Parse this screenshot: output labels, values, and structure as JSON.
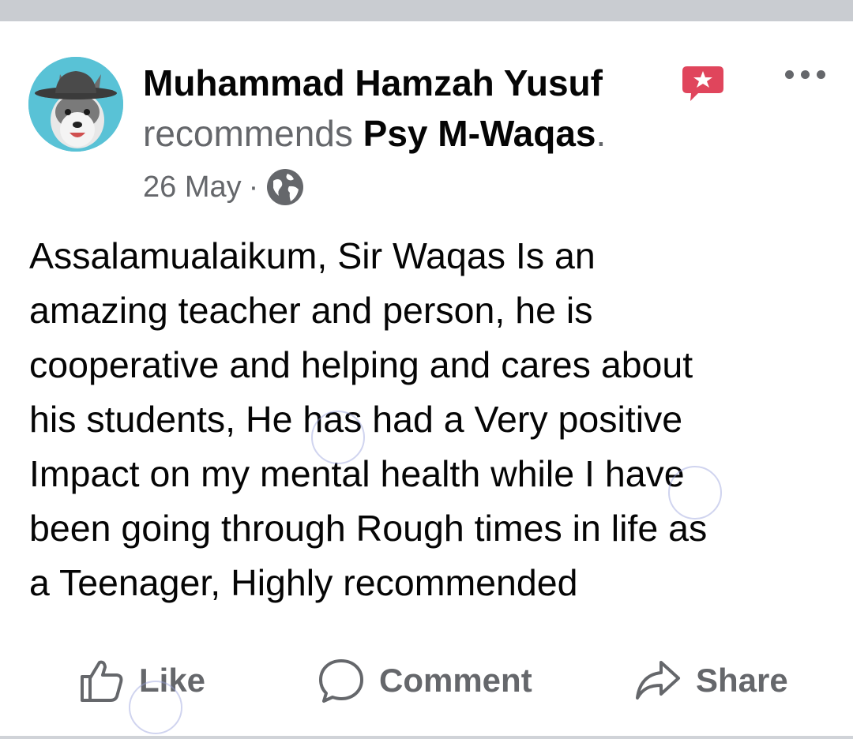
{
  "post": {
    "author": "Muhammad Hamzah Yusuf",
    "action_text": "recommends",
    "page_name": "Psy M-Waqas",
    "period": ".",
    "date": "26 May",
    "separator": "·",
    "privacy_icon": "globe-icon",
    "badge_icon": "star-speech-bubble-icon",
    "more_icon": "more-dots-icon",
    "body_lines": [
      "Assalamualaikum, Sir Waqas Is an",
      "amazing teacher and person, he is",
      "cooperative and helping and cares about",
      "his students, He has had a Very positive",
      "Impact on my mental health while I have",
      "been going through Rough times in life as",
      "a Teenager, Highly recommended"
    ]
  },
  "actions": {
    "like_label": "Like",
    "like_icon": "thumbs-up-icon",
    "comment_label": "Comment",
    "comment_icon": "speech-bubble-icon",
    "share_label": "Share",
    "share_icon": "share-arrow-icon"
  },
  "colors": {
    "text_primary": "#050505",
    "text_secondary": "#65676b",
    "badge": "#e0455c",
    "avatar_bg": "#59c2d6",
    "top_bar": "#c9ccd1"
  }
}
